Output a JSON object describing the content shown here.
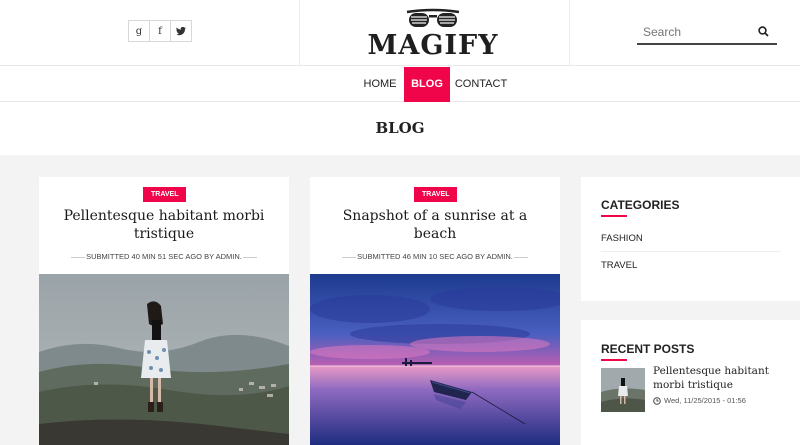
{
  "header": {
    "social": [
      {
        "icon": "google-plus-icon",
        "glyph": "g"
      },
      {
        "icon": "facebook-icon",
        "glyph": "f"
      },
      {
        "icon": "twitter-icon",
        "glyph": "t"
      }
    ],
    "logo_text": "MAGIFY",
    "search_placeholder": "Search"
  },
  "nav": {
    "items": [
      {
        "label": "HOME",
        "active": false
      },
      {
        "label": "BLOG",
        "active": true
      },
      {
        "label": "CONTACT",
        "active": false
      }
    ]
  },
  "page": {
    "title": "BLOG"
  },
  "posts": [
    {
      "tag": "TRAVEL",
      "title": "Pellentesque habitant morbi tristique",
      "meta": "SUBMITTED 40 MIN 51 SEC AGO BY ADMIN."
    },
    {
      "tag": "TRAVEL",
      "title": "Snapshot of a sunrise at a beach",
      "meta": "SUBMITTED 46 MIN 10 SEC AGO BY ADMIN."
    }
  ],
  "sidebar": {
    "categories": {
      "heading": "CATEGORIES",
      "items": [
        "FASHION",
        "TRAVEL"
      ]
    },
    "recent_posts": {
      "heading": "RECENT POSTS",
      "items": [
        {
          "title": "Pellentesque habitant morbi tristique",
          "date": "Wed, 11/25/2015 - 01:56"
        }
      ]
    }
  },
  "colors": {
    "accent": "#f0054a",
    "background": "#f3f3f3"
  }
}
